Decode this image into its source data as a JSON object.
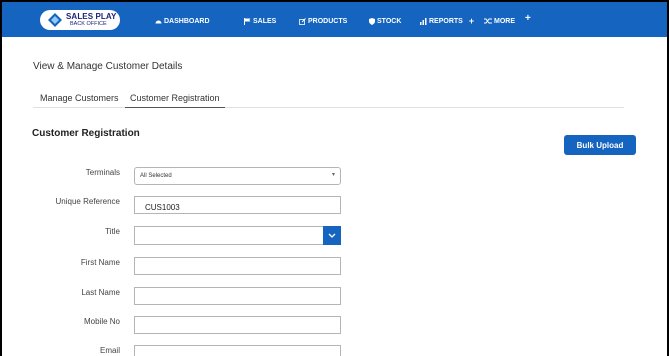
{
  "brand": {
    "title": "SALES PLAY",
    "subtitle": "BACK OFFICE"
  },
  "nav": {
    "items": [
      {
        "label": "DASHBOARD",
        "icon": "dashboard-icon"
      },
      {
        "label": "SALES",
        "icon": "flag-icon"
      },
      {
        "label": "PRODUCTS",
        "icon": "edit-icon"
      },
      {
        "label": "STOCK",
        "icon": "shield-icon"
      },
      {
        "label": "REPORTS",
        "icon": "bar-chart-icon"
      },
      {
        "label": "MORE",
        "icon": "shuffle-icon"
      }
    ],
    "plus": "+"
  },
  "page": {
    "title": "View & Manage Customer Details",
    "tabs": [
      {
        "label": "Manage Customers",
        "active": false
      },
      {
        "label": "Customer Registration",
        "active": true
      }
    ],
    "section_title": "Customer Registration",
    "bulk_upload_label": "Bulk Upload"
  },
  "form": {
    "terminals": {
      "label": "Terminals",
      "value": "All Selected"
    },
    "unique_reference": {
      "label": "Unique Reference",
      "value": "CUS1003"
    },
    "title": {
      "label": "Title",
      "value": ""
    },
    "first_name": {
      "label": "First Name",
      "value": ""
    },
    "last_name": {
      "label": "Last Name",
      "value": ""
    },
    "mobile_no": {
      "label": "Mobile No",
      "value": ""
    },
    "email": {
      "label": "Email",
      "value": ""
    }
  },
  "colors": {
    "primary": "#1565c0",
    "background": "#ffffff"
  }
}
